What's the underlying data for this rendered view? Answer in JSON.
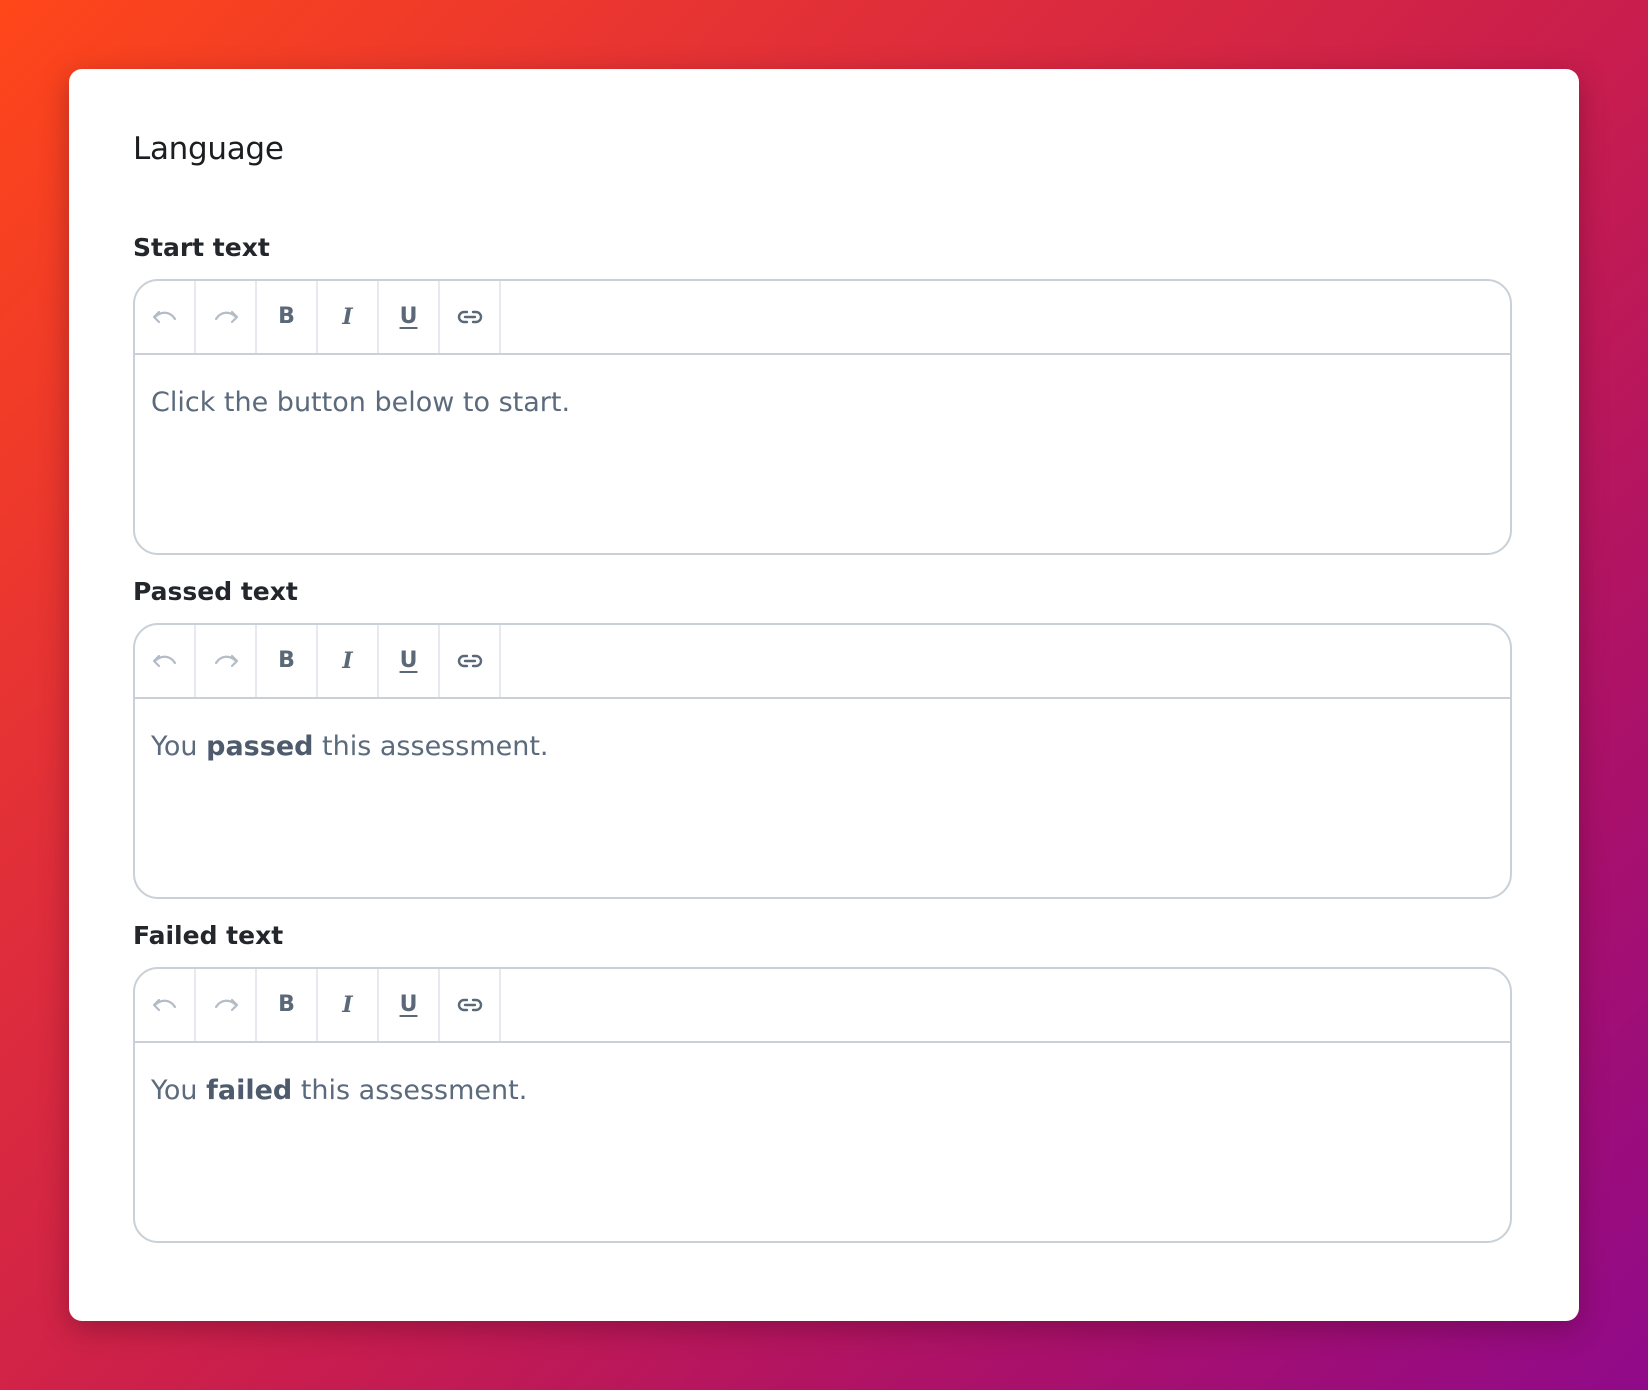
{
  "card": {
    "title": "Language"
  },
  "toolbar_buttons": {
    "undo": "undo-icon",
    "redo": "redo-icon",
    "bold": "B",
    "italic": "I",
    "underline": "U",
    "link": "link-icon"
  },
  "fields": [
    {
      "label": "Start text",
      "content": {
        "before": "Click the button below to start.",
        "bold": "",
        "after": ""
      }
    },
    {
      "label": "Passed text",
      "content": {
        "before": "You ",
        "bold": "passed",
        "after": " this assessment."
      }
    },
    {
      "label": "Failed text",
      "content": {
        "before": "You ",
        "bold": "failed",
        "after": " this assessment."
      }
    }
  ],
  "colors": {
    "background_gradient_start": "#ff4719",
    "background_gradient_end": "#900a8a",
    "card": "#ffffff",
    "border": "#c9d0d8",
    "toolbar_icon": "#5b6878",
    "toolbar_icon_disabled": "#b4bcc6",
    "body_text": "#5b6a7c"
  }
}
